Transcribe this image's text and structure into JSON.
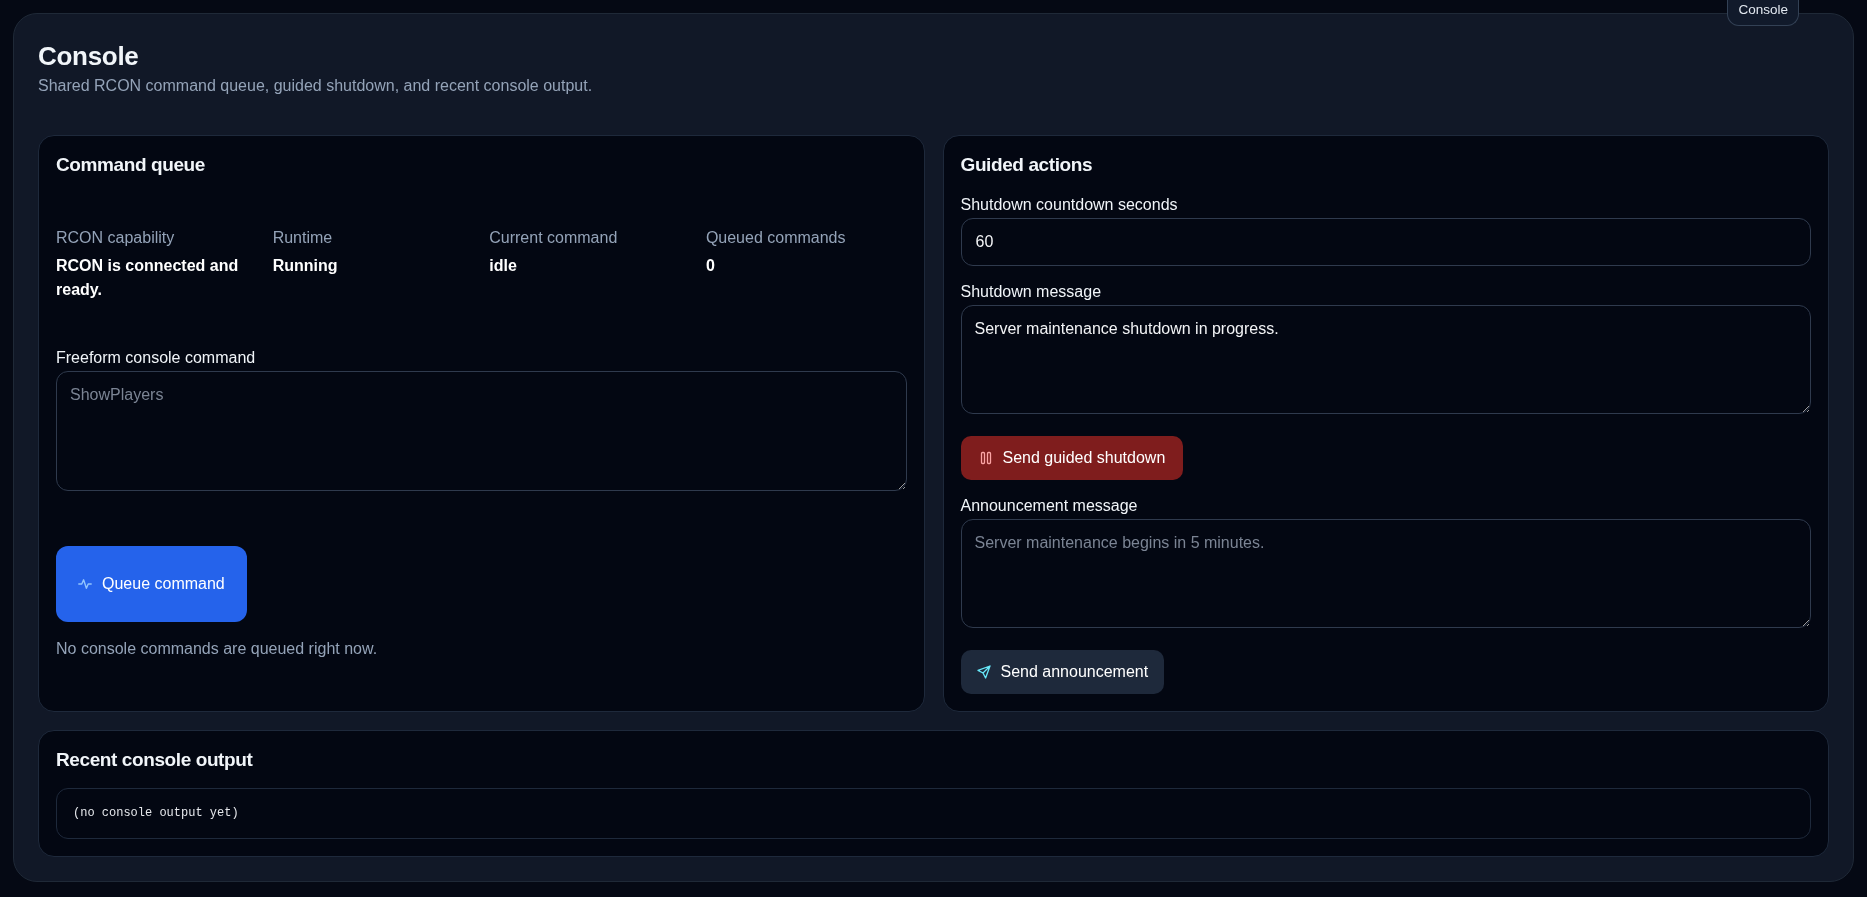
{
  "tooltip": {
    "text": "Console"
  },
  "page": {
    "title": "Console",
    "subtitle": "Shared RCON command queue, guided shutdown, and recent console output."
  },
  "command_queue": {
    "title": "Command queue",
    "stats": [
      {
        "label": "RCON capability",
        "value": "RCON is connected and ready."
      },
      {
        "label": "Runtime",
        "value": "Running"
      },
      {
        "label": "Current command",
        "value": "idle"
      },
      {
        "label": "Queued commands",
        "value": "0"
      }
    ],
    "command_field": {
      "label": "Freeform console command",
      "placeholder": "ShowPlayers"
    },
    "queue_button": {
      "label": "Queue command",
      "kind": "primary"
    },
    "status_text": "No console commands are queued right now."
  },
  "guided_actions": {
    "title": "Guided actions",
    "items": [
      {
        "kind": "input",
        "label": "Shutdown countdown seconds",
        "value": "60"
      },
      {
        "kind": "textarea",
        "label": "Shutdown message",
        "value": "Server maintenance shutdown in progress."
      },
      {
        "kind": "danger",
        "label": "Send guided shutdown"
      },
      {
        "kind": "textarea",
        "label": "Announcement message",
        "placeholder": "Server maintenance begins in 5 minutes."
      },
      {
        "kind": "secondary",
        "label": "Send announcement"
      }
    ]
  },
  "console_output": {
    "title": "Recent console output",
    "text": "(no console output yet)"
  }
}
